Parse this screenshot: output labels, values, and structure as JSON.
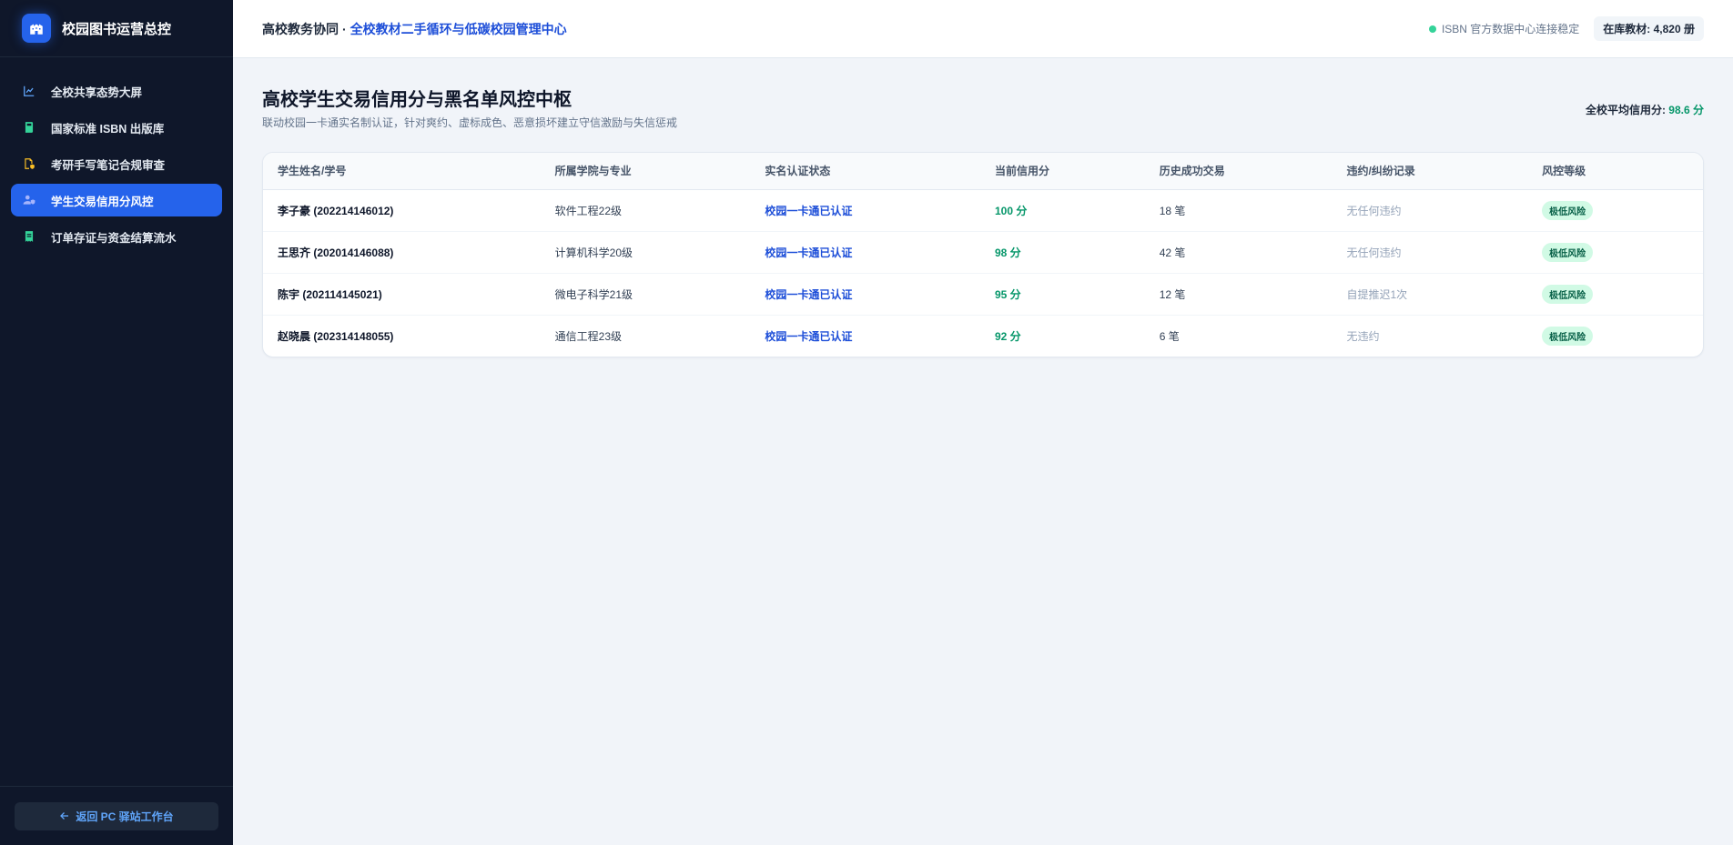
{
  "sidebar": {
    "brand_title": "校园图书运营总控",
    "items": [
      {
        "label": "全校共享态势大屏",
        "icon": "line-chart-icon"
      },
      {
        "label": "国家标准 ISBN 出版库",
        "icon": "book-icon"
      },
      {
        "label": "考研手写笔记合规审查",
        "icon": "file-shield-icon"
      },
      {
        "label": "学生交易信用分风控",
        "icon": "user-shield-icon"
      },
      {
        "label": "订单存证与资金结算流水",
        "icon": "receipt-icon"
      }
    ],
    "back_label": "返回 PC 驿站工作台"
  },
  "topbar": {
    "crumb_prefix": "高校教务协同",
    "crumb_sep": "·",
    "crumb_highlight": "全校教材二手循环与低碳校园管理中心",
    "status_text": "ISBN 官方数据中心连接稳定",
    "stock_badge": "在库教材: 4,820 册"
  },
  "page": {
    "title": "高校学生交易信用分与黑名单风控中枢",
    "subtitle": "联动校园一卡通实名制认证，针对爽约、虚标成色、恶意损坏建立守信激励与失信惩戒",
    "avg_label": "全校平均信用分:",
    "avg_value": "98.6 分"
  },
  "table": {
    "headers": [
      "学生姓名/学号",
      "所属学院与专业",
      "实名认证状态",
      "当前信用分",
      "历史成功交易",
      "违约/纠纷记录",
      "风控等级"
    ],
    "rows": [
      [
        "李子豪 (202214146012)",
        "软件工程22级",
        "校园一卡通已认证",
        "100 分",
        "18 笔",
        "无任何违约",
        "极低风险"
      ],
      [
        "王思齐 (202014146088)",
        "计算机科学20级",
        "校园一卡通已认证",
        "98 分",
        "42 笔",
        "无任何违约",
        "极低风险"
      ],
      [
        "陈宇 (202114145021)",
        "微电子科学21级",
        "校园一卡通已认证",
        "95 分",
        "12 笔",
        "自提推迟1次",
        "极低风险"
      ],
      [
        "赵晓晨 (202314148055)",
        "通信工程23级",
        "校园一卡通已认证",
        "92 分",
        "6 笔",
        "无违约",
        "极低风险"
      ]
    ]
  },
  "colors": {
    "sidebar_bg": "#0f172a",
    "accent": "#2563eb",
    "score_green": "#059669",
    "auth_blue": "#1d4ed8",
    "risk_badge_bg": "#d1fae5"
  }
}
